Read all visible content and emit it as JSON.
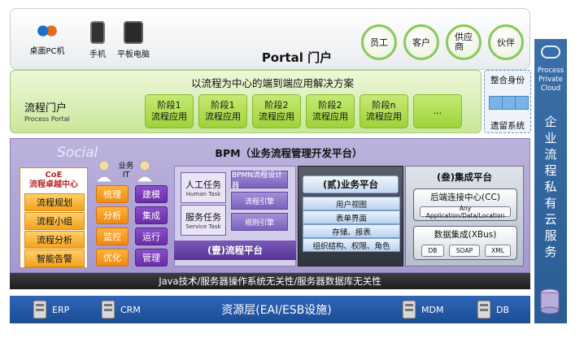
{
  "top": {
    "devices": [
      {
        "label": "桌面PC机",
        "icon": "browser-icons"
      },
      {
        "label": "手机",
        "icon": "phone-icon"
      },
      {
        "label": "平板电脑",
        "icon": "tablet-icon"
      }
    ],
    "roles": [
      "员工",
      "客户",
      "供应\n商",
      "伙伴"
    ],
    "portal_title": "Portal 门户"
  },
  "process": {
    "subtitle": "以流程为中心的端到端应用解决方案",
    "portal_label_zh": "流程门户",
    "portal_label_en": "Process Portal",
    "phases": [
      {
        "line1": "阶段1",
        "line2": "流程应用"
      },
      {
        "line1": "阶段1",
        "line2": "流程应用"
      },
      {
        "line1": "阶段2",
        "line2": "流程应用"
      },
      {
        "line1": "阶段2",
        "line2": "流程应用"
      },
      {
        "line1": "阶段n",
        "line2": "流程应用"
      },
      {
        "line1": "...",
        "line2": ""
      }
    ]
  },
  "identity": {
    "title": "整合身份",
    "subtitle": "遗留系统"
  },
  "cloud": {
    "en": "Process\nPrivate\nCloud",
    "zh": [
      "企",
      "业",
      "流",
      "程",
      "私",
      "有",
      "云",
      "服",
      "务"
    ]
  },
  "bpm": {
    "social": "Social",
    "title": "BPM（业务流程管理开发平台）",
    "coe_title": "CoE\n流程卓越中心",
    "coe_items": [
      "流程规划",
      "流程小组",
      "流程分析",
      "智能告警"
    ],
    "bizit_label": "业务\nIT",
    "biz_col": [
      "梳理",
      "分析",
      "监控",
      "优化"
    ],
    "it_col": [
      "建模",
      "集成",
      "运行",
      "管理"
    ],
    "human_task_zh": "人工任务",
    "human_task_en": "Human Task",
    "service_task_zh": "服务任务",
    "service_task_en": "Service Task",
    "engines": [
      "BPMN流程设计器",
      "流程引擎",
      "规则引擎"
    ],
    "process_platform": "(壹)流程平台",
    "biz_platform_title": "(贰)业务平台",
    "biz_platform_items": [
      "用户视图",
      "表单界面",
      "存储、报表",
      "组织结构、权限、角色"
    ],
    "integration_title": "(叁)集成平台",
    "cc_title": "后端连接中心(CC)",
    "cc_sub": "Any Application/Data/Location",
    "xbus_title": "数据集成(XBus)",
    "xbus_items": [
      "DB",
      "SOAP",
      "XML"
    ]
  },
  "java": "Java技术/服务器操作系统无关性/服务器数据库无关性",
  "resource": {
    "title": "资源层(EAI/ESB设施)",
    "items": [
      "ERP",
      "CRM",
      "MDM",
      "DB"
    ]
  },
  "colors": {
    "green_band": "#c9e79a",
    "purple_band": "#a498cf",
    "cloud_blue": "#2b5c95",
    "resource_blue": "#1c4c95",
    "orange": "#f3a21c"
  }
}
